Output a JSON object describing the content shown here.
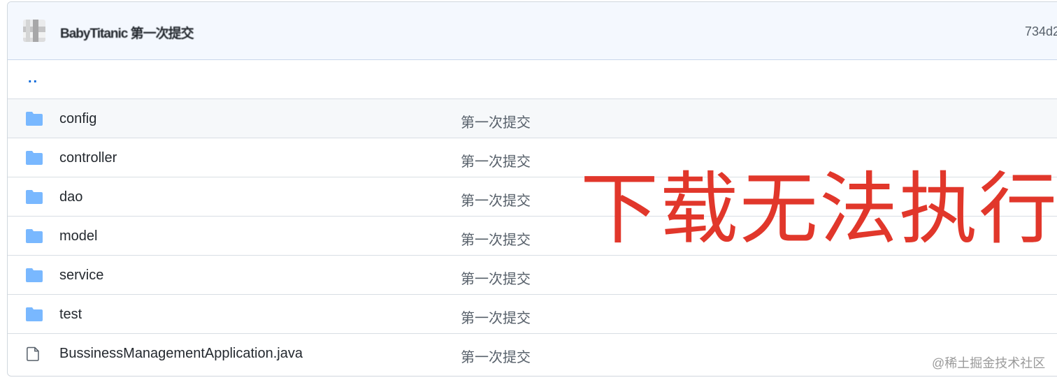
{
  "header": {
    "commit_message": "BabyTitanic 第一次提交",
    "commit_hash": "734d2"
  },
  "parent_dir": {
    "label": ".."
  },
  "files": [
    {
      "name": "config",
      "type": "folder",
      "commit": "第一次提交"
    },
    {
      "name": "controller",
      "type": "folder",
      "commit": "第一次提交"
    },
    {
      "name": "dao",
      "type": "folder",
      "commit": "第一次提交"
    },
    {
      "name": "model",
      "type": "folder",
      "commit": "第一次提交"
    },
    {
      "name": "service",
      "type": "folder",
      "commit": "第一次提交"
    },
    {
      "name": "test",
      "type": "folder",
      "commit": "第一次提交"
    },
    {
      "name": "BussinessManagementApplication.java",
      "type": "file",
      "commit": "第一次提交"
    }
  ],
  "overlay": {
    "text": "下载无法执行",
    "color": "#e1372b"
  },
  "watermark": {
    "text": "@稀土掘金技术社区"
  },
  "colors": {
    "folder": "#79b8ff",
    "link": "#0969da",
    "header_bg": "#f4f8fe"
  }
}
